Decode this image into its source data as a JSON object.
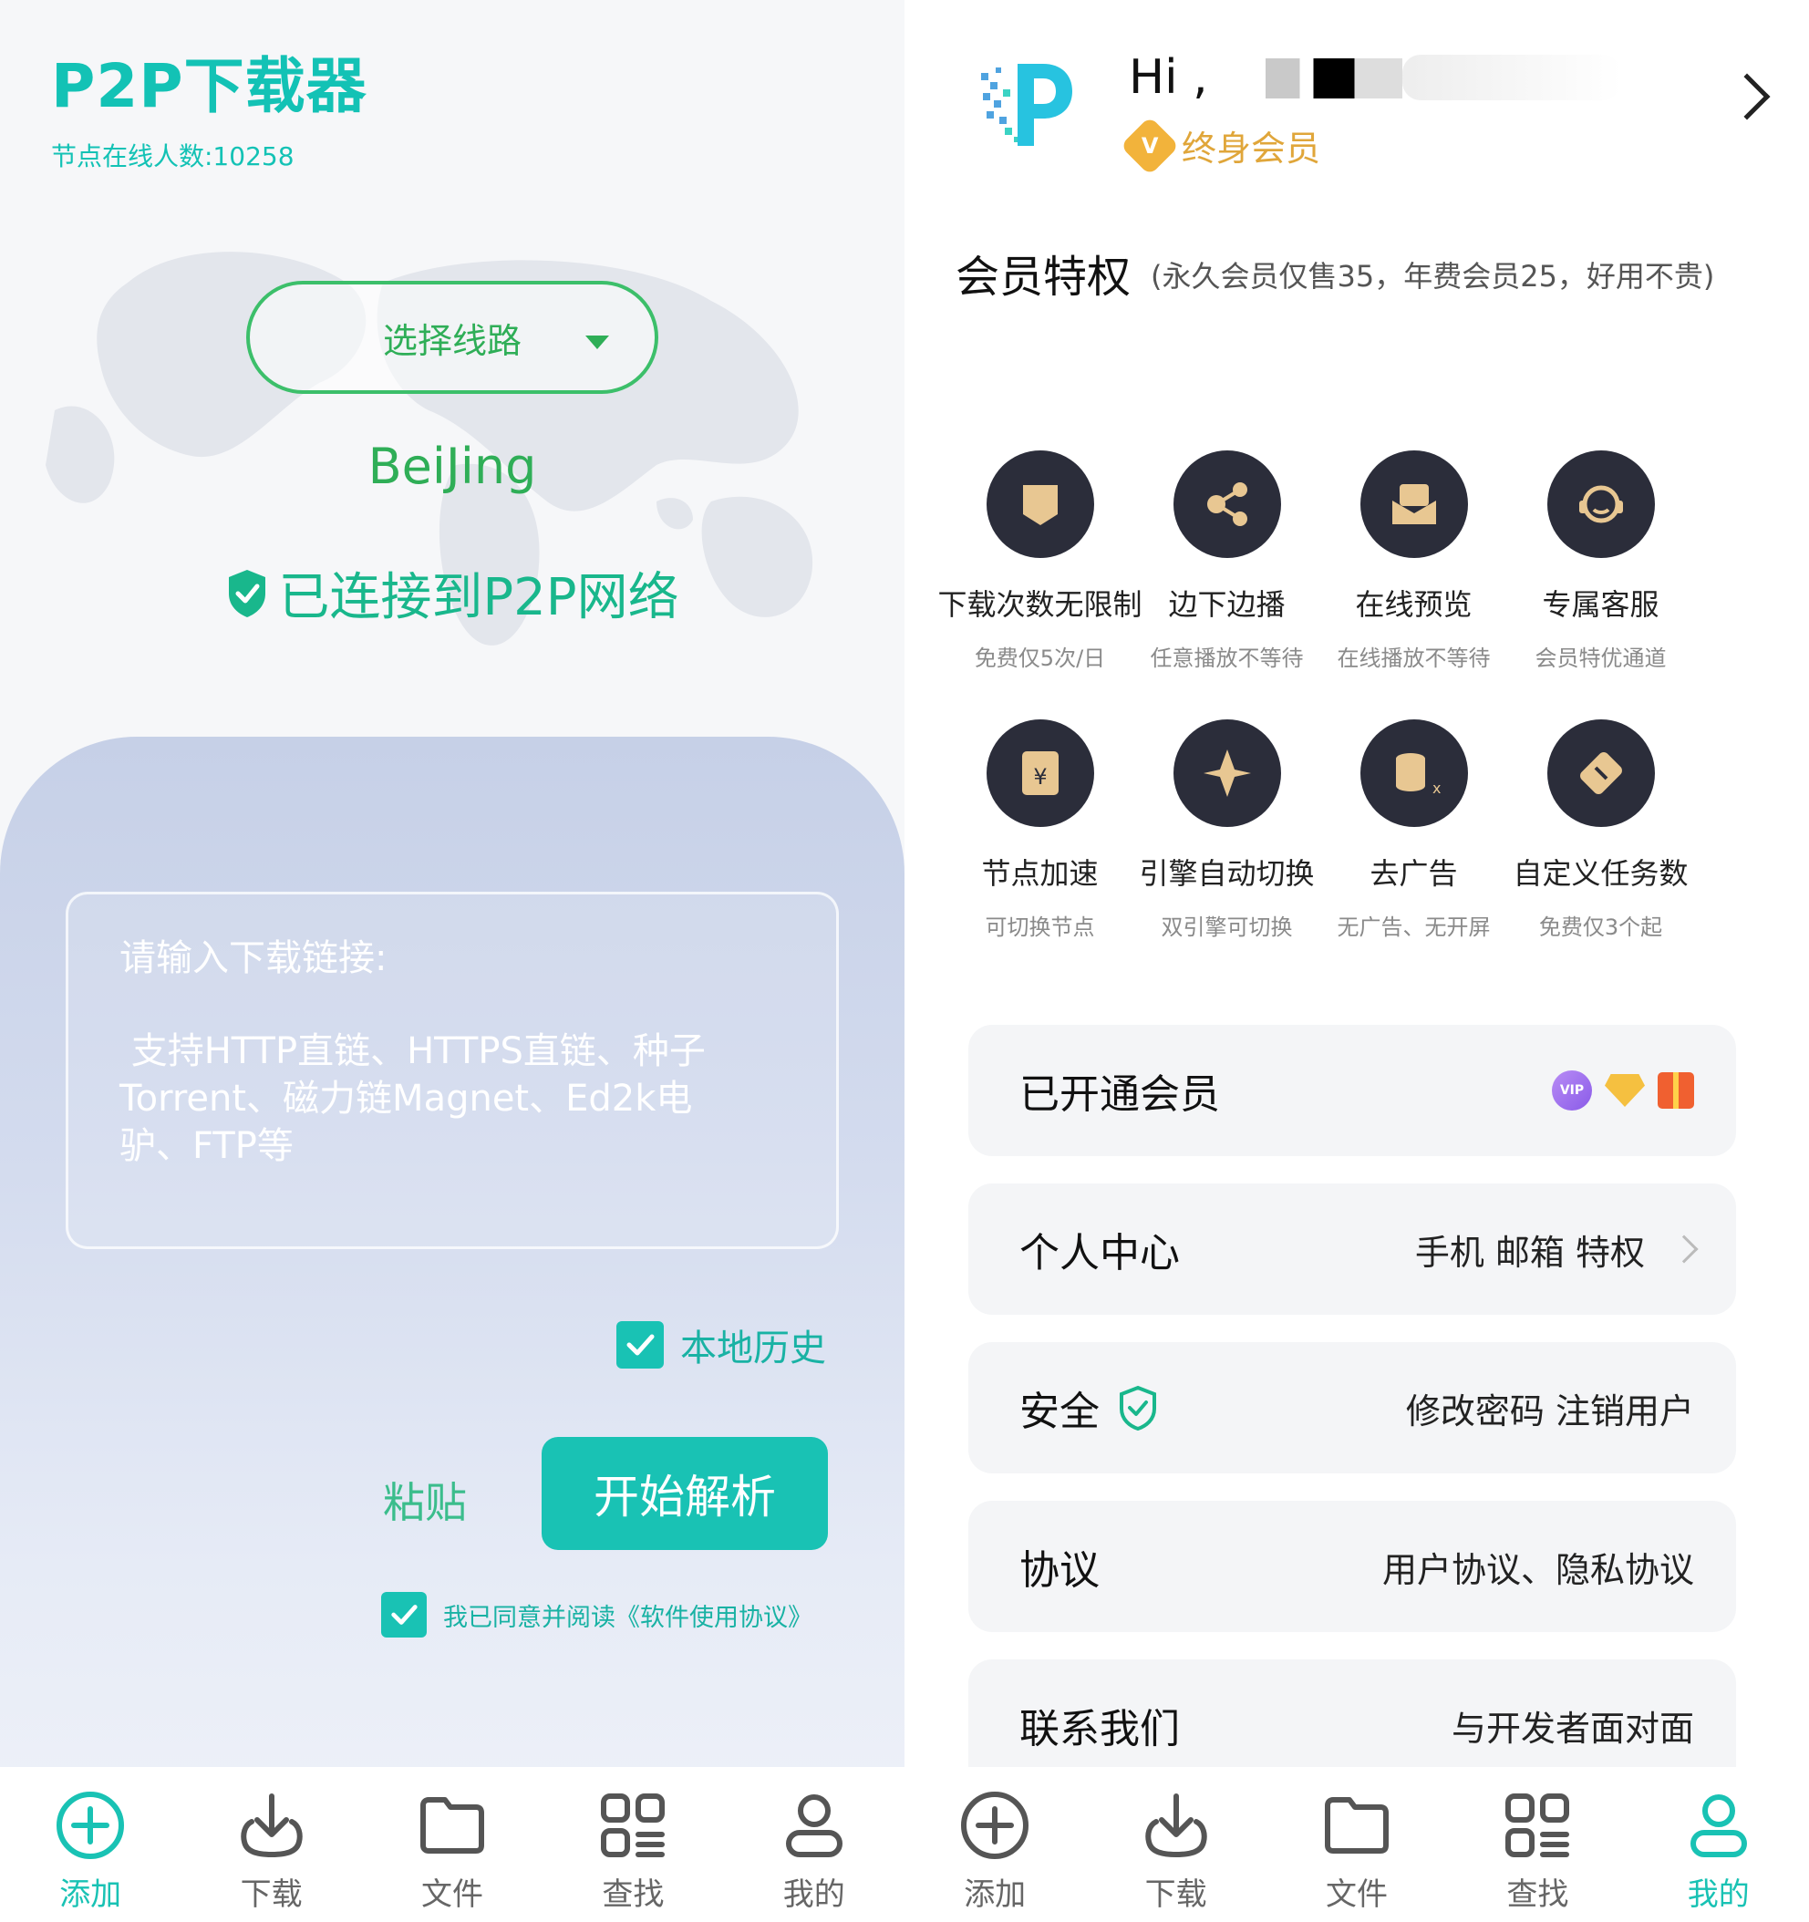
{
  "left": {
    "app_title": "P2P下载器",
    "online_text": "节点在线人数:10258",
    "route_button": "选择线路",
    "city": "BeiJing",
    "connected_text": "已连接到P2P网络",
    "input": {
      "line1": "请输入下载链接:",
      "line2": " 支持HTTP直链、HTTPS直链、种子\nTorrent、磁力链Magnet、Ed2k电\n驴、FTP等"
    },
    "history_label": "本地历史",
    "paste_label": "粘贴",
    "start_label": "开始解析",
    "agree_label": "我已同意并阅读《软件使用协议》",
    "tabs": [
      "添加",
      "下载",
      "文件",
      "查找",
      "我的"
    ],
    "active_tab": "添加"
  },
  "right": {
    "greeting": "Hi ,",
    "membership": "终身会员",
    "member_badge": "V",
    "privileges_title": "会员特权",
    "privileges_note": "(永久会员仅售35，年费会员25，好用不贵)",
    "perks": [
      {
        "name": "下载次数无限制",
        "desc": "免费仅5次/日",
        "icon": "shield-icon"
      },
      {
        "name": "边下边播",
        "desc": "任意播放不等待",
        "icon": "share-icon"
      },
      {
        "name": "在线预览",
        "desc": "在线播放不等待",
        "icon": "envelope-icon"
      },
      {
        "name": "专属客服",
        "desc": "会员特优通道",
        "icon": "headset-icon"
      },
      {
        "name": "节点加速",
        "desc": "可切换节点",
        "icon": "wallet-icon"
      },
      {
        "name": "引擎自动切换",
        "desc": "双引擎可切换",
        "icon": "switch-icon"
      },
      {
        "name": "去广告",
        "desc": "无广告、无开屏",
        "icon": "coins-icon"
      },
      {
        "name": "自定义任务数",
        "desc": "免费仅3个起",
        "icon": "ticket-icon"
      }
    ],
    "rows": [
      {
        "left": "已开通会员",
        "right": ""
      },
      {
        "left": "个人中心",
        "right": "手机 邮箱 特权"
      },
      {
        "left": "安全",
        "right": "修改密码  注销用户"
      },
      {
        "left": "协议",
        "right": "用户协议、隐私协议"
      },
      {
        "left": "联系我们",
        "right": "与开发者面对面"
      }
    ],
    "vip_badge_text": "VIP",
    "tabs": [
      "添加",
      "下载",
      "文件",
      "查找",
      "我的"
    ],
    "active_tab": "我的"
  },
  "colors": {
    "accent": "#19c2b4",
    "green": "#2fae57",
    "dark_icon": "#2b2d3a",
    "gold": "#e0a63a"
  }
}
